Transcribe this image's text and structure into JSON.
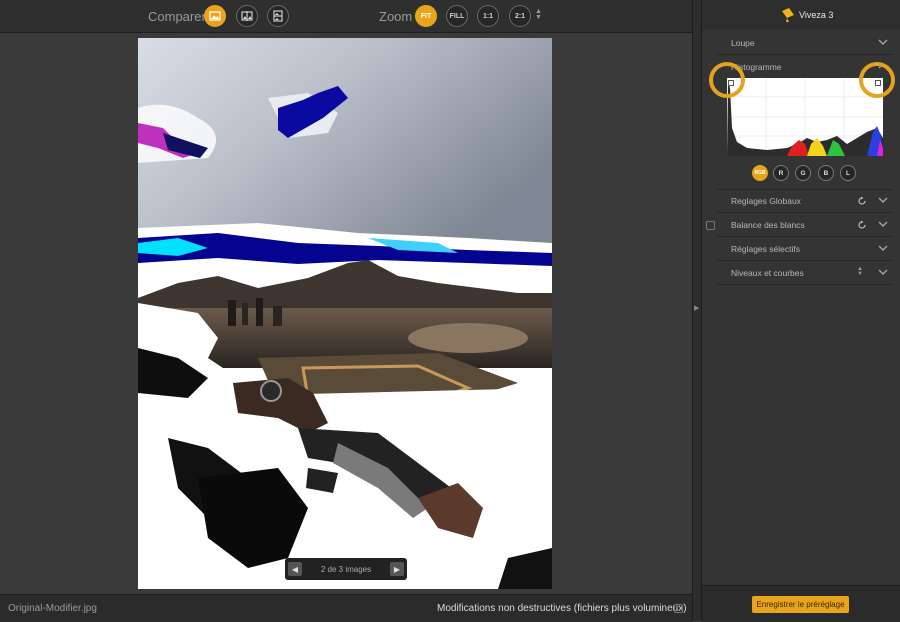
{
  "toolbar": {
    "compare_label": "Comparer",
    "zoom_label": "Zoom",
    "zoom_fit": "FIT",
    "zoom_fill": "FILL",
    "zoom_1_1": "1:1",
    "zoom_2_1": "2:1"
  },
  "canvas": {
    "nav_text": "2 de 3 images"
  },
  "footer": {
    "filename": "Original-Modifier.jpg",
    "non_destructive_label": "Modifications non destructives (fichiers plus volumineux)"
  },
  "panel": {
    "brand": "Viveza 3",
    "sections": {
      "loupe": "Loupe",
      "histogram": "Histogramme",
      "global": "Reglages Globaux",
      "white_balance": "Balance des blancs",
      "selective": "Réglages sélectifs",
      "levels": "Niveaux et courbes"
    },
    "channels": [
      "RGB",
      "R",
      "G",
      "B",
      "L"
    ],
    "save_button": "Enregistrer le préréglage"
  },
  "colors": {
    "accent": "#e8a51c",
    "panel_bg": "#343434",
    "canvas_bg": "#3a3a3a"
  }
}
